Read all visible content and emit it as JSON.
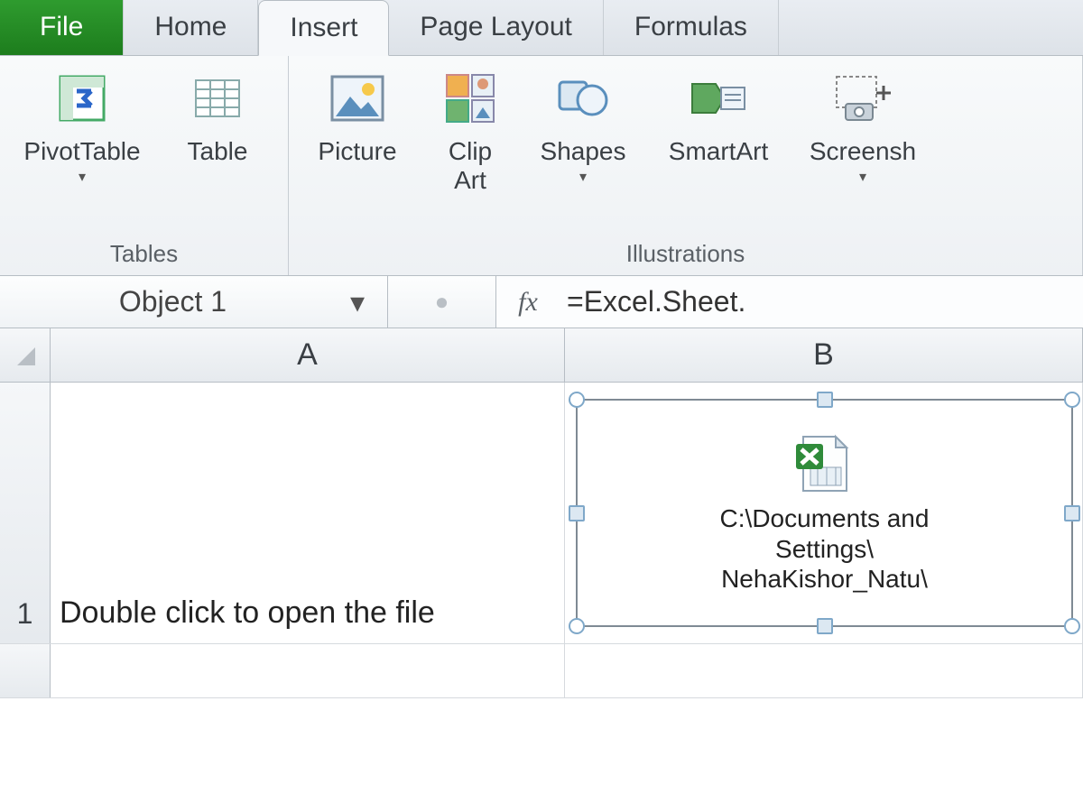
{
  "tabs": {
    "file": "File",
    "home": "Home",
    "insert": "Insert",
    "page_layout": "Page Layout",
    "formulas": "Formulas"
  },
  "ribbon": {
    "groups": {
      "tables": {
        "label": "Tables",
        "pivot": "PivotTable",
        "table": "Table"
      },
      "illustrations": {
        "label": "Illustrations",
        "picture": "Picture",
        "clipart_l1": "Clip",
        "clipart_l2": "Art",
        "shapes": "Shapes",
        "smartart": "SmartArt",
        "screenshot": "Screensh"
      }
    }
  },
  "formula_bar": {
    "name_box": "Object 1",
    "fx": "fx",
    "formula": "=Excel.Sheet."
  },
  "grid": {
    "col_headers": [
      "A",
      "B"
    ],
    "row_headers": [
      "1"
    ],
    "cells": {
      "A1": "Double click to open the file"
    }
  },
  "embedded_object": {
    "caption_line1": "C:\\Documents and",
    "caption_line2": "Settings\\",
    "caption_line3": "NehaKishor_Natu\\"
  }
}
